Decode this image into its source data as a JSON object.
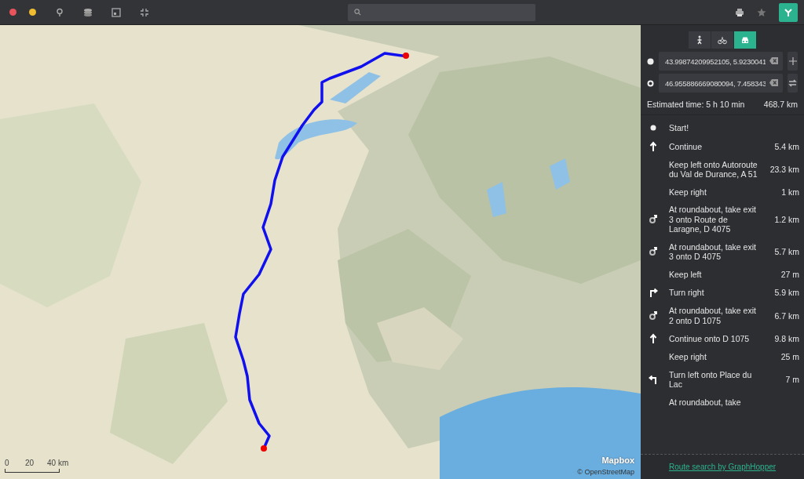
{
  "vehicles": [
    {
      "kind": "foot",
      "selected": false
    },
    {
      "kind": "bike",
      "selected": false
    },
    {
      "kind": "car",
      "selected": true
    }
  ],
  "points": [
    {
      "kind": "start",
      "value": "43.99874209952105, 5.9230041"
    },
    {
      "kind": "end",
      "value": "46.955886669080094, 7.458343"
    }
  ],
  "summary": {
    "time": "Estimated time: 5 h 10 min",
    "distance": "468.7 km"
  },
  "steps": [
    {
      "kind": "start",
      "text": "Start!"
    },
    {
      "kind": "continue",
      "text": "Continue",
      "distance": "5.4 km"
    },
    {
      "kind": "keep",
      "text": "Keep left onto Autoroute du Val de Durance, A 51",
      "distance": "23.3 km"
    },
    {
      "kind": "keep",
      "text": "Keep right",
      "distance": "1 km"
    },
    {
      "kind": "roundabout",
      "text": "At roundabout, take exit 3 onto Route de Laragne, D 4075",
      "distance": "1.2 km"
    },
    {
      "kind": "roundabout",
      "text": "At roundabout, take exit 3 onto D 4075",
      "distance": "5.7 km"
    },
    {
      "kind": "keep",
      "text": "Keep left",
      "distance": "27 m"
    },
    {
      "kind": "turn_right",
      "text": "Turn right",
      "distance": "5.9 km"
    },
    {
      "kind": "roundabout",
      "text": "At roundabout, take exit 2 onto D 1075",
      "distance": "6.7 km"
    },
    {
      "kind": "continue",
      "text": "Continue onto D 1075",
      "distance": "9.8 km"
    },
    {
      "kind": "keep",
      "text": "Keep right",
      "distance": "25 m"
    },
    {
      "kind": "turn_left",
      "text": "Turn left onto Place du Lac",
      "distance": "7 m"
    },
    {
      "kind": "roundabout_cut",
      "text": "At roundabout, take"
    }
  ],
  "footer": {
    "link": "Route search by GraphHopper"
  },
  "map": {
    "logo": "Mapbox",
    "attribution": "© OpenStreetMap",
    "scale": [
      "0",
      "20",
      "40 km"
    ]
  }
}
